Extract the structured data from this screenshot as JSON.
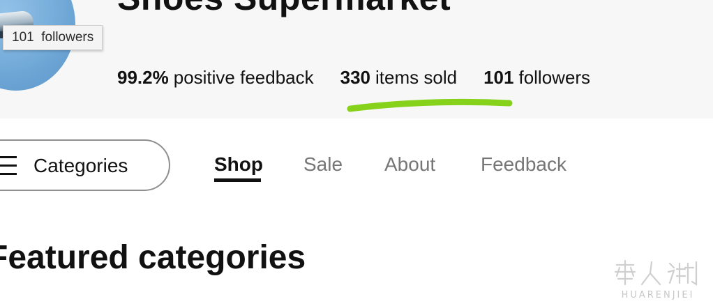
{
  "header": {
    "store_title": "Shoes Supermarket",
    "tooltip_text": "101  followers",
    "stats": {
      "feedback_value": "99.2%",
      "feedback_label": "positive feedback",
      "sold_value": "330",
      "sold_label": "items sold",
      "followers_value": "101",
      "followers_label": "followers"
    },
    "highlight_color": "#86d21a"
  },
  "nav": {
    "categories_label": "Categories",
    "tabs": [
      {
        "label": "Shop",
        "active": true
      },
      {
        "label": "Sale",
        "active": false
      },
      {
        "label": "About",
        "active": false
      },
      {
        "label": "Feedback",
        "active": false
      }
    ]
  },
  "main": {
    "section_heading": "Featured categories"
  },
  "watermark": {
    "text": "HUARENJIEI"
  },
  "icons": {
    "menu": "hamburger-menu-icon"
  }
}
